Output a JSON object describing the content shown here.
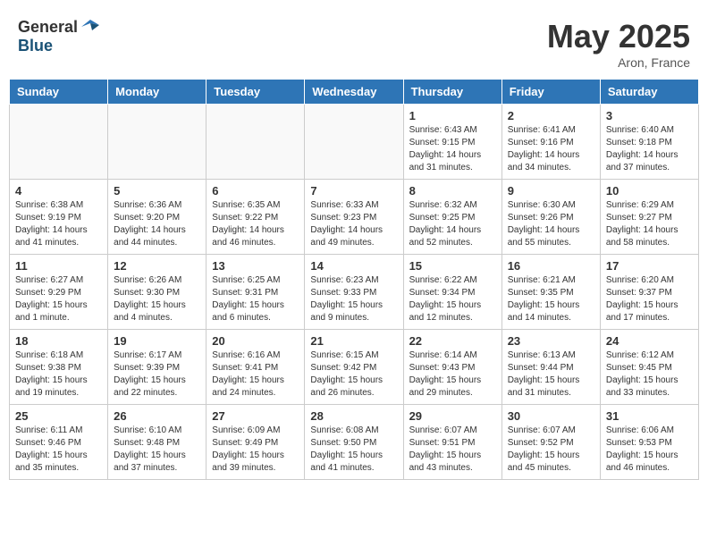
{
  "header": {
    "logo_general": "General",
    "logo_blue": "Blue",
    "month": "May 2025",
    "location": "Aron, France"
  },
  "weekdays": [
    "Sunday",
    "Monday",
    "Tuesday",
    "Wednesday",
    "Thursday",
    "Friday",
    "Saturday"
  ],
  "weeks": [
    [
      {
        "day": "",
        "info": ""
      },
      {
        "day": "",
        "info": ""
      },
      {
        "day": "",
        "info": ""
      },
      {
        "day": "",
        "info": ""
      },
      {
        "day": "1",
        "info": "Sunrise: 6:43 AM\nSunset: 9:15 PM\nDaylight: 14 hours\nand 31 minutes."
      },
      {
        "day": "2",
        "info": "Sunrise: 6:41 AM\nSunset: 9:16 PM\nDaylight: 14 hours\nand 34 minutes."
      },
      {
        "day": "3",
        "info": "Sunrise: 6:40 AM\nSunset: 9:18 PM\nDaylight: 14 hours\nand 37 minutes."
      }
    ],
    [
      {
        "day": "4",
        "info": "Sunrise: 6:38 AM\nSunset: 9:19 PM\nDaylight: 14 hours\nand 41 minutes."
      },
      {
        "day": "5",
        "info": "Sunrise: 6:36 AM\nSunset: 9:20 PM\nDaylight: 14 hours\nand 44 minutes."
      },
      {
        "day": "6",
        "info": "Sunrise: 6:35 AM\nSunset: 9:22 PM\nDaylight: 14 hours\nand 46 minutes."
      },
      {
        "day": "7",
        "info": "Sunrise: 6:33 AM\nSunset: 9:23 PM\nDaylight: 14 hours\nand 49 minutes."
      },
      {
        "day": "8",
        "info": "Sunrise: 6:32 AM\nSunset: 9:25 PM\nDaylight: 14 hours\nand 52 minutes."
      },
      {
        "day": "9",
        "info": "Sunrise: 6:30 AM\nSunset: 9:26 PM\nDaylight: 14 hours\nand 55 minutes."
      },
      {
        "day": "10",
        "info": "Sunrise: 6:29 AM\nSunset: 9:27 PM\nDaylight: 14 hours\nand 58 minutes."
      }
    ],
    [
      {
        "day": "11",
        "info": "Sunrise: 6:27 AM\nSunset: 9:29 PM\nDaylight: 15 hours\nand 1 minute."
      },
      {
        "day": "12",
        "info": "Sunrise: 6:26 AM\nSunset: 9:30 PM\nDaylight: 15 hours\nand 4 minutes."
      },
      {
        "day": "13",
        "info": "Sunrise: 6:25 AM\nSunset: 9:31 PM\nDaylight: 15 hours\nand 6 minutes."
      },
      {
        "day": "14",
        "info": "Sunrise: 6:23 AM\nSunset: 9:33 PM\nDaylight: 15 hours\nand 9 minutes."
      },
      {
        "day": "15",
        "info": "Sunrise: 6:22 AM\nSunset: 9:34 PM\nDaylight: 15 hours\nand 12 minutes."
      },
      {
        "day": "16",
        "info": "Sunrise: 6:21 AM\nSunset: 9:35 PM\nDaylight: 15 hours\nand 14 minutes."
      },
      {
        "day": "17",
        "info": "Sunrise: 6:20 AM\nSunset: 9:37 PM\nDaylight: 15 hours\nand 17 minutes."
      }
    ],
    [
      {
        "day": "18",
        "info": "Sunrise: 6:18 AM\nSunset: 9:38 PM\nDaylight: 15 hours\nand 19 minutes."
      },
      {
        "day": "19",
        "info": "Sunrise: 6:17 AM\nSunset: 9:39 PM\nDaylight: 15 hours\nand 22 minutes."
      },
      {
        "day": "20",
        "info": "Sunrise: 6:16 AM\nSunset: 9:41 PM\nDaylight: 15 hours\nand 24 minutes."
      },
      {
        "day": "21",
        "info": "Sunrise: 6:15 AM\nSunset: 9:42 PM\nDaylight: 15 hours\nand 26 minutes."
      },
      {
        "day": "22",
        "info": "Sunrise: 6:14 AM\nSunset: 9:43 PM\nDaylight: 15 hours\nand 29 minutes."
      },
      {
        "day": "23",
        "info": "Sunrise: 6:13 AM\nSunset: 9:44 PM\nDaylight: 15 hours\nand 31 minutes."
      },
      {
        "day": "24",
        "info": "Sunrise: 6:12 AM\nSunset: 9:45 PM\nDaylight: 15 hours\nand 33 minutes."
      }
    ],
    [
      {
        "day": "25",
        "info": "Sunrise: 6:11 AM\nSunset: 9:46 PM\nDaylight: 15 hours\nand 35 minutes."
      },
      {
        "day": "26",
        "info": "Sunrise: 6:10 AM\nSunset: 9:48 PM\nDaylight: 15 hours\nand 37 minutes."
      },
      {
        "day": "27",
        "info": "Sunrise: 6:09 AM\nSunset: 9:49 PM\nDaylight: 15 hours\nand 39 minutes."
      },
      {
        "day": "28",
        "info": "Sunrise: 6:08 AM\nSunset: 9:50 PM\nDaylight: 15 hours\nand 41 minutes."
      },
      {
        "day": "29",
        "info": "Sunrise: 6:07 AM\nSunset: 9:51 PM\nDaylight: 15 hours\nand 43 minutes."
      },
      {
        "day": "30",
        "info": "Sunrise: 6:07 AM\nSunset: 9:52 PM\nDaylight: 15 hours\nand 45 minutes."
      },
      {
        "day": "31",
        "info": "Sunrise: 6:06 AM\nSunset: 9:53 PM\nDaylight: 15 hours\nand 46 minutes."
      }
    ]
  ]
}
